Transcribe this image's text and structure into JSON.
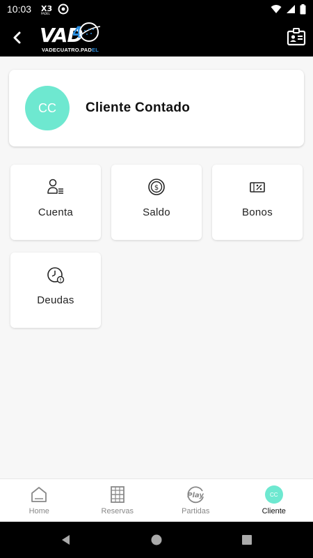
{
  "status_bar": {
    "time": "10:03"
  },
  "app_bar": {
    "logo_text": "VAD4",
    "logo_sub_main": "VADECUATRO",
    "logo_sub_dot": ".",
    "logo_sub_pad": "PAD",
    "logo_sub_accent": "EL"
  },
  "client": {
    "initials": "CC",
    "name": "Cliente Contado"
  },
  "tiles": [
    {
      "label": "Cuenta",
      "icon": "user-list-icon"
    },
    {
      "label": "Saldo",
      "icon": "dollar-coin-icon"
    },
    {
      "label": "Bonos",
      "icon": "percent-ticket-icon"
    },
    {
      "label": "Deudas",
      "icon": "clock-alert-icon"
    }
  ],
  "bottom_nav": [
    {
      "label": "Home",
      "icon": "home-icon",
      "active": false
    },
    {
      "label": "Reservas",
      "icon": "court-icon",
      "active": false
    },
    {
      "label": "Partidas",
      "icon": "play-icon",
      "active": false
    },
    {
      "label": "Cliente",
      "icon": "avatar-icon",
      "active": true,
      "initials": "CC"
    }
  ],
  "colors": {
    "accent": "#6ee8d0",
    "bar": "#000000",
    "logo_accent": "#2b8fe0"
  }
}
